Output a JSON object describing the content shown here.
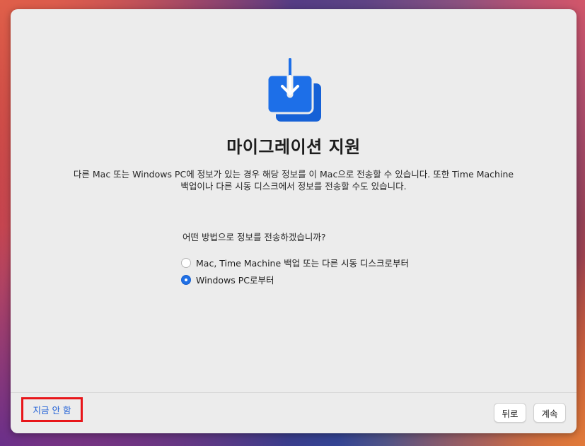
{
  "title": "마이그레이션 지원",
  "description": "다른 Mac 또는 Windows PC에 정보가 있는 경우 해당 정보를 이 Mac으로 전송할 수 있습니다. 또한 Time Machine 백업이나 다른 시동 디스크에서 정보를 전송할 수도 있습니다.",
  "question": "어떤 방법으로 정보를 전송하겠습니까?",
  "options": [
    {
      "label": "Mac, Time Machine 백업 또는 다른 시동 디스크로부터",
      "selected": false
    },
    {
      "label": "Windows PC로부터",
      "selected": true
    }
  ],
  "footer": {
    "not_now_label": "지금 안 함",
    "back_label": "뒤로",
    "continue_label": "계속"
  },
  "icon": "migration-download-icon",
  "colors": {
    "accent": "#1f6fe5",
    "link": "#1f5fd6",
    "highlight_box": "#e8161a"
  }
}
